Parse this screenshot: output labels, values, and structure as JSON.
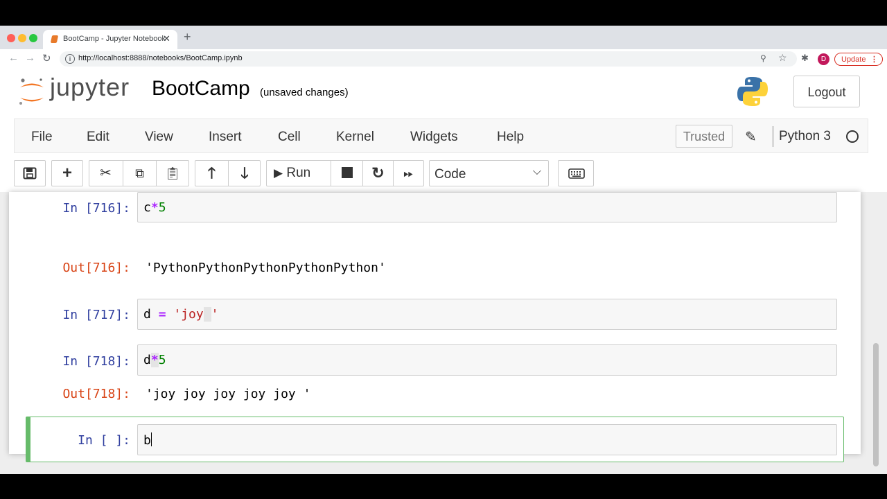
{
  "browser": {
    "tab_title": "BootCamp - Jupyter Notebook",
    "url": "http://localhost:8888/notebooks/BootCamp.ipynb",
    "profile_initial": "D",
    "update_label": "Update",
    "new_tab_symbol": "+",
    "close_tab_symbol": "✕"
  },
  "header": {
    "logo_text": "jupyter",
    "notebook_name": "BootCamp",
    "save_status": "(unsaved changes)",
    "logout_label": "Logout"
  },
  "menubar": {
    "items": [
      "File",
      "Edit",
      "View",
      "Insert",
      "Cell",
      "Kernel",
      "Widgets",
      "Help"
    ],
    "trusted_label": "Trusted",
    "kernel_name": "Python 3"
  },
  "toolbar": {
    "run_label": "Run",
    "cell_type": "Code"
  },
  "cells": [
    {
      "type": "in",
      "prompt": "In [716]:",
      "code": "c*5"
    },
    {
      "type": "out",
      "prompt": "Out[716]:",
      "text": "'PythonPythonPythonPythonPython'"
    },
    {
      "type": "in",
      "prompt": "In [717]:",
      "code": "d = 'joy '"
    },
    {
      "type": "in",
      "prompt": "In [718]:",
      "code": "d*5"
    },
    {
      "type": "out",
      "prompt": "Out[718]:",
      "text": "'joy joy joy joy joy '"
    },
    {
      "type": "in",
      "prompt": "In [ ]:",
      "code": "b",
      "selected": true
    }
  ],
  "colors": {
    "in_prompt": "#303f9f",
    "out_prompt": "#d84315",
    "selected_border": "#66bb6a",
    "logo_orange": "#f37726"
  }
}
